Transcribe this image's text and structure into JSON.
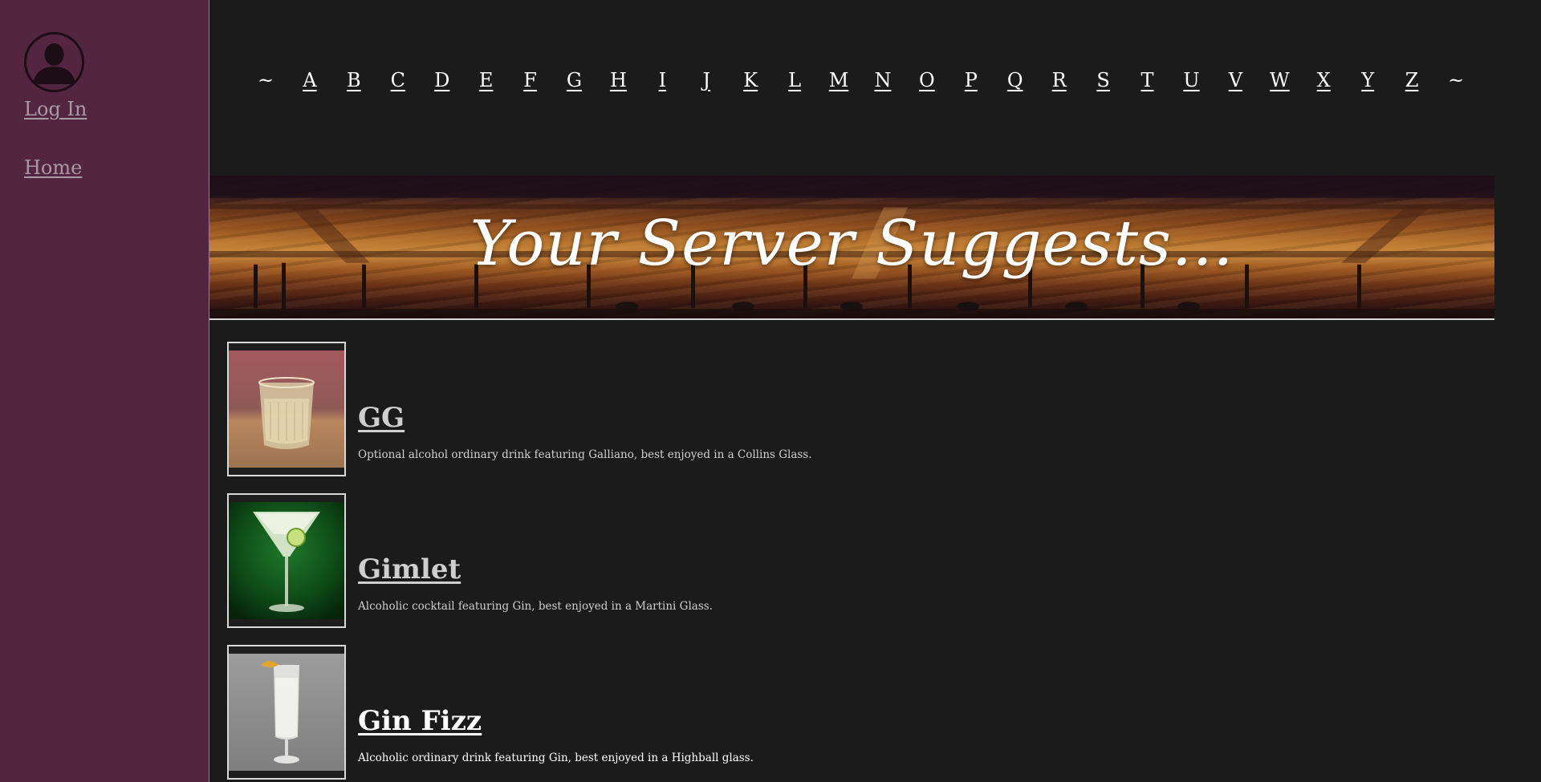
{
  "sidebar": {
    "login_label": "Log In",
    "home_label": "Home"
  },
  "alphabet": [
    "~",
    "A",
    "B",
    "C",
    "D",
    "E",
    "F",
    "G",
    "H",
    "I",
    "J",
    "K",
    "L",
    "M",
    "N",
    "O",
    "P",
    "Q",
    "R",
    "S",
    "T",
    "U",
    "V",
    "W",
    "X",
    "Y",
    "Z",
    "~"
  ],
  "banner": {
    "title": "Your Server Suggests..."
  },
  "drinks": [
    {
      "name": "GG",
      "description": "Optional alcohol ordinary drink featuring Galliano, best enjoyed in a Collins Glass."
    },
    {
      "name": "Gimlet",
      "description": "Alcoholic cocktail featuring Gin, best enjoyed in a Martini Glass."
    },
    {
      "name": "Gin Fizz",
      "description": "Alcoholic ordinary drink featuring Gin, best enjoyed in a Highball glass."
    }
  ],
  "colors": {
    "sidebar_bg": "#532541",
    "main_bg": "#1b1b1b",
    "link_muted": "#a89aa3",
    "text": "#ffffff"
  }
}
